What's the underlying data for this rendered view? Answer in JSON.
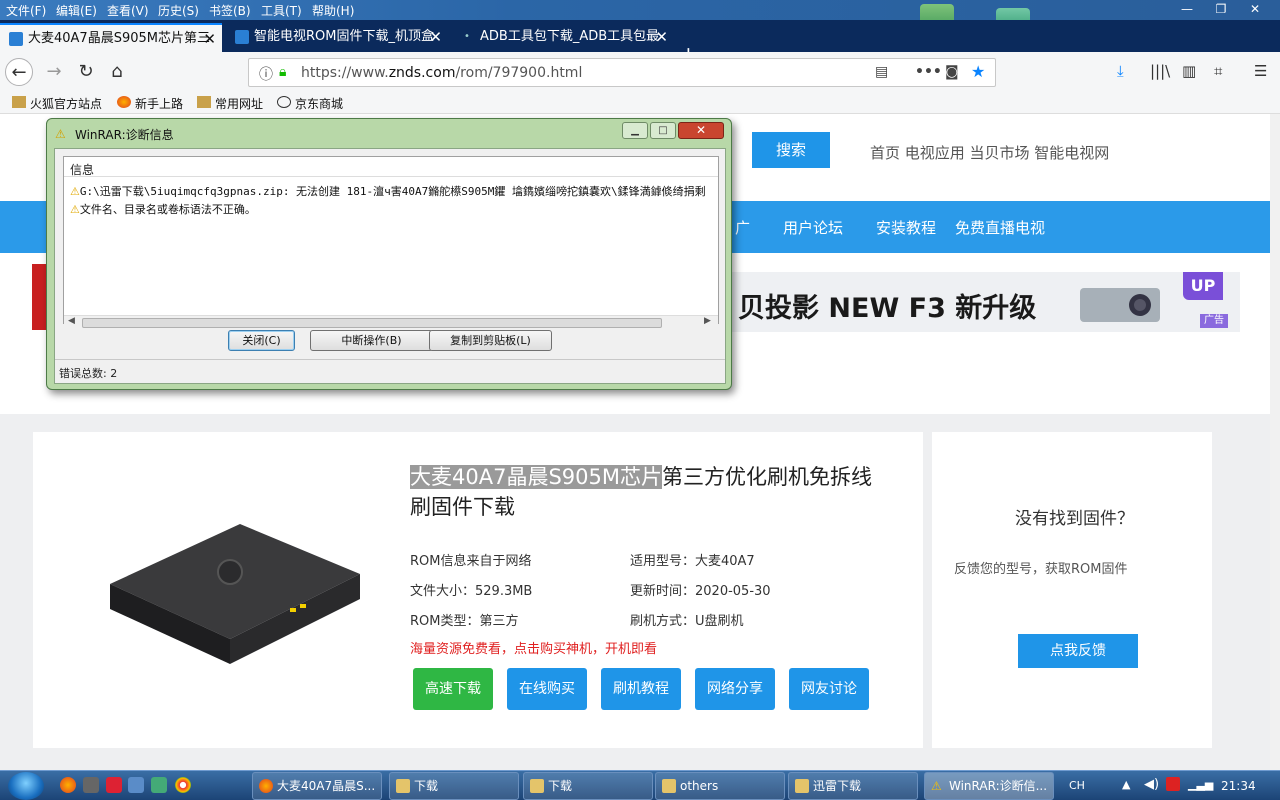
{
  "menubar": {
    "items": [
      "文件(F)",
      "编辑(E)",
      "查看(V)",
      "历史(S)",
      "书签(B)",
      "工具(T)",
      "帮助(H)"
    ]
  },
  "tabs": [
    {
      "title": "大麦40A7晶晨S905M芯片第三",
      "active": true
    },
    {
      "title": "智能电视ROM固件下载_机顶盒",
      "active": false
    },
    {
      "title": "ADB工具包下载_ADB工具包最",
      "active": false
    }
  ],
  "url": {
    "prefix": "https://www.",
    "domain": "znds.com",
    "path": "/rom/797900.html"
  },
  "bookmarks": [
    "火狐官方站点",
    "新手上路",
    "常用网址",
    "京东商城"
  ],
  "page": {
    "search_label": "搜索",
    "top_nav": "首页 电视应用 当贝市场 智能电视网",
    "blue_links": [
      "广",
      "用户论坛",
      "安装教程",
      "免费直播电视"
    ],
    "banner_text": "贝投影 NEW F3 新升级",
    "banner_up": "UP",
    "banner_ad": "广告",
    "product_title_hl": "大麦40A7晶晨S905M芯片",
    "product_title_rest": "第三方优化刷机免拆线",
    "product_title_line2": "刷固件下载",
    "meta": [
      "ROM信息来自于网络",
      "适用型号：大麦40A7",
      "文件大小：529.3MB",
      "更新时间：2020-05-30",
      "ROM类型：第三方",
      "刷机方式：U盘刷机"
    ],
    "promo": "海量资源免费看，点击购买神机，开机即看",
    "buttons": [
      "高速下载",
      "在线购买",
      "刷机教程",
      "网络分享",
      "网友讨论"
    ],
    "side_title": "没有找到固件？",
    "side_desc": "反馈您的型号，获取ROM固件",
    "side_button": "点我反馈"
  },
  "dialog": {
    "title": "WinRAR:诊断信息",
    "list_header": "信息",
    "messages": [
      "G:\\迅雷下载\\5iuqimqcfq3gpnas.zip: 无法创建 181-澶ч害40A7鏅舵櫒S905M鑺  墖鐫嬪缁嗙拕鎮嚢欢\\鍒锋満鎼倐绮捐剩",
      "文件名、目录名或卷标语法不正确。"
    ],
    "buttons": {
      "close": "关闭(C)",
      "abort": "中断操作(B)",
      "copy": "复制到剪贴板(L)"
    },
    "status": "错误总数: 2"
  },
  "taskbar": {
    "tasks": [
      {
        "label": "大麦40A7晶晨S...",
        "active": false
      },
      {
        "label": "下载",
        "active": false
      },
      {
        "label": "下载",
        "active": false
      },
      {
        "label": "others",
        "active": false
      },
      {
        "label": "迅雷下载",
        "active": false
      },
      {
        "label": "WinRAR:诊断信...",
        "active": true
      }
    ],
    "tray_lang": "CH",
    "clock": "21:34"
  },
  "colors": {
    "accent": "#1f95e8",
    "firefox_tab_indicator": "#0a84ff",
    "promo_red": "#e02020",
    "download_green": "#2fb744"
  }
}
